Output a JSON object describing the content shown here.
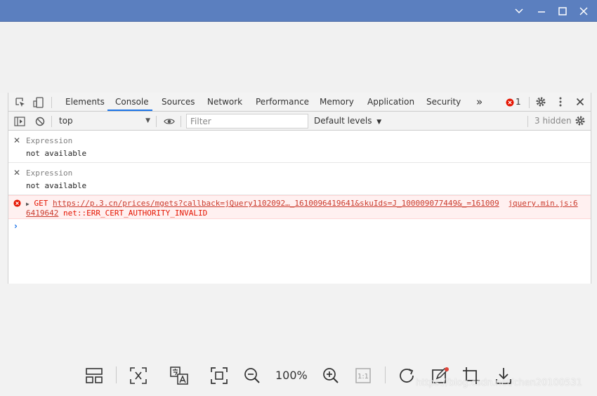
{
  "colors": {
    "titlebar": "#5b7fbf",
    "active_tab": "#1a73e8",
    "error_text": "#e51400",
    "error_bg": "#fff0f0"
  },
  "tabs": [
    {
      "label": "Elements"
    },
    {
      "label": "Console"
    },
    {
      "label": "Sources"
    },
    {
      "label": "Network"
    },
    {
      "label": "Performance"
    },
    {
      "label": "Memory"
    },
    {
      "label": "Application"
    },
    {
      "label": "Security"
    }
  ],
  "active_tab": "Console",
  "more_tabs_label": "»",
  "error_count": "1",
  "toolbar": {
    "context": "top",
    "filter_placeholder": "Filter",
    "levels_label": "Default levels",
    "hidden_label": "3 hidden"
  },
  "expressions": [
    {
      "label": "Expression",
      "value": "not available"
    },
    {
      "label": "Expression",
      "value": "not available"
    }
  ],
  "error": {
    "method": "GET",
    "url": "https://p.3.cn/prices/mgets?callback=jQuery1102092…_1610096419641&skuIds=J_100009077449&_=161009",
    "source": "jquery.min.js:6",
    "url_cont": "6419642",
    "message": "net::ERR_CERT_AUTHORITY_INVALID"
  },
  "viewer": {
    "zoom": "100%",
    "ratio_label": "1:1",
    "watermark": "https://blog.csdn.net/chen20100531"
  }
}
